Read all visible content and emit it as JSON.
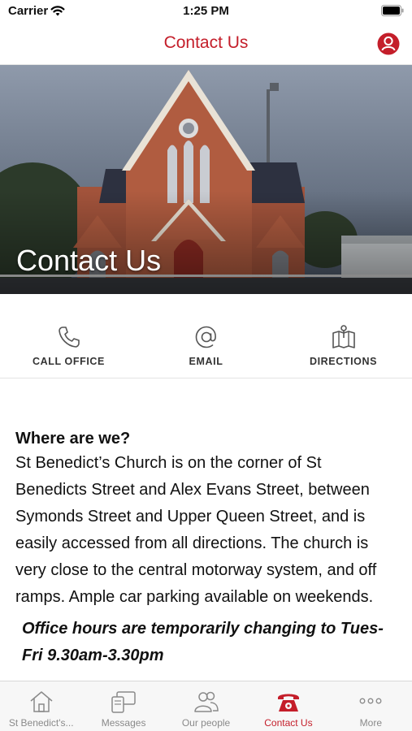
{
  "status_bar": {
    "carrier": "Carrier",
    "time": "1:25 PM"
  },
  "nav": {
    "title": "Contact Us"
  },
  "hero": {
    "title": "Contact Us"
  },
  "actions": [
    {
      "label": "CALL OFFICE",
      "icon": "phone-icon"
    },
    {
      "label": "EMAIL",
      "icon": "at-icon"
    },
    {
      "label": "DIRECTIONS",
      "icon": "map-icon"
    }
  ],
  "content": {
    "heading": "Where are we?",
    "body": "St Benedict’s Church is on the corner of St Benedicts Street and Alex Evans Street, between Symonds Street and Upper Queen Street, and is easily accessed from all directions. The church is very close to the central motorway system, and off ramps. Ample car parking available on weekends.",
    "note": "Office hours are temporarily changing to Tues-Fri 9.30am-3.30pm"
  },
  "tabs": [
    {
      "label": "St Benedict's...",
      "icon": "home-icon",
      "active": false
    },
    {
      "label": "Messages",
      "icon": "messages-icon",
      "active": false
    },
    {
      "label": "Our people",
      "icon": "people-icon",
      "active": false
    },
    {
      "label": "Contact Us",
      "icon": "phone-icon",
      "active": true
    },
    {
      "label": "More",
      "icon": "more-icon",
      "active": false
    }
  ],
  "colors": {
    "accent": "#c41e2a",
    "inactive": "#8a8a8a"
  }
}
